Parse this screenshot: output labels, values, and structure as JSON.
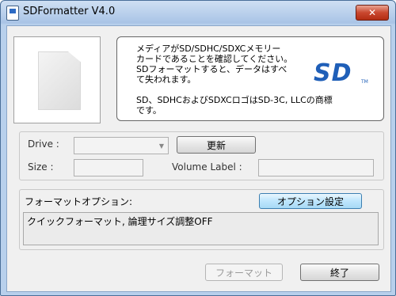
{
  "window": {
    "title": "SDFormatter V4.0",
    "close_label": "✕"
  },
  "info": {
    "line1": "メディアがSD/SDHC/SDXCメモリー",
    "line2": "カードであることを確認してください。",
    "line3": "SDフォーマットすると、データはすべ",
    "line4": "て失われます。",
    "trademark1": "SD、SDHCおよびSDXCロゴはSD-3C, LLCの商標",
    "trademark2": "です。",
    "logo_text": "SD",
    "logo_tm": "TM",
    "logo_color": "#1f5fb8"
  },
  "drive": {
    "drive_label": "Drive :",
    "drive_value": "",
    "refresh_label": "更新",
    "size_label": "Size :",
    "size_value": "",
    "volume_label": "Volume Label :",
    "volume_value": ""
  },
  "options": {
    "heading": "フォーマットオプション:",
    "settings_button": "オプション設定",
    "current_value": "クイックフォーマット, 論理サイズ調整OFF"
  },
  "footer": {
    "format_button": "フォーマット",
    "exit_button": "終了"
  }
}
